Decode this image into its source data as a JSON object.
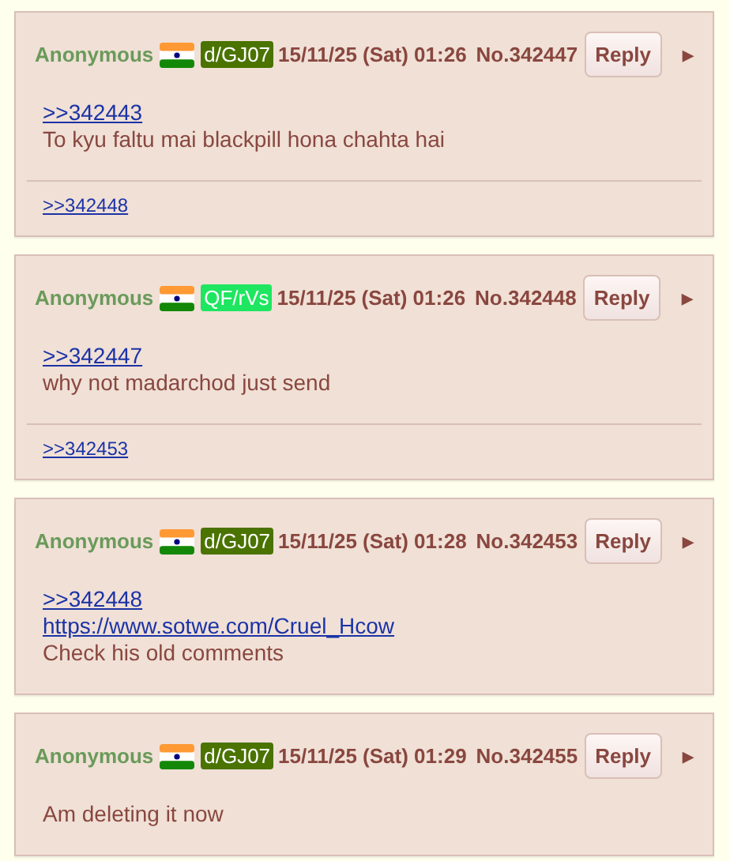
{
  "posts": [
    {
      "name": "Anonymous",
      "id": {
        "text": "d/GJ07",
        "color": "#4a7300"
      },
      "datetime": "15/11/25 (Sat) 01:26",
      "number": "No.342447",
      "reply_label": "Reply",
      "menu_glyph": "▶",
      "lines": [
        {
          "kind": "quote",
          "text": ">>342443"
        },
        {
          "kind": "text",
          "text": "To kyu faltu mai blackpill hona chahta hai"
        }
      ],
      "backlinks": [
        ">>342448"
      ]
    },
    {
      "name": "Anonymous",
      "id": {
        "text": "QF/rVs",
        "color": "#1ee660"
      },
      "datetime": "15/11/25 (Sat) 01:26",
      "number": "No.342448",
      "reply_label": "Reply",
      "menu_glyph": "▶",
      "lines": [
        {
          "kind": "quote",
          "text": ">>342447"
        },
        {
          "kind": "text",
          "text": "why not madarchod just send"
        }
      ],
      "backlinks": [
        ">>342453"
      ]
    },
    {
      "name": "Anonymous",
      "id": {
        "text": "d/GJ07",
        "color": "#4a7300"
      },
      "datetime": "15/11/25 (Sat) 01:28",
      "number": "No.342453",
      "reply_label": "Reply",
      "menu_glyph": "▶",
      "lines": [
        {
          "kind": "quote",
          "text": ">>342448"
        },
        {
          "kind": "url",
          "text": "https://www.sotwe.com/Cruel_Hcow"
        },
        {
          "kind": "text",
          "text": "Check his old comments"
        }
      ]
    },
    {
      "name": "Anonymous",
      "id": {
        "text": "d/GJ07",
        "color": "#4a7300"
      },
      "datetime": "15/11/25 (Sat) 01:29",
      "number": "No.342455",
      "reply_label": "Reply",
      "menu_glyph": "▶",
      "lines": [
        {
          "kind": "text",
          "text": "Am deleting it now"
        }
      ]
    }
  ]
}
